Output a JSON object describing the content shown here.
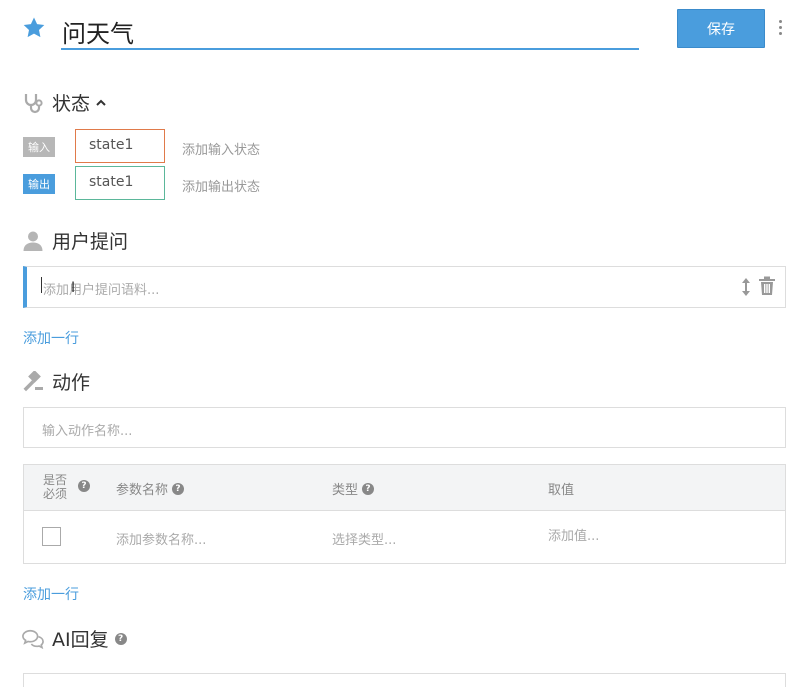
{
  "header": {
    "title": "问天气",
    "save_label": "保存"
  },
  "state": {
    "title": "状态",
    "input_tag": "输入",
    "output_tag": "输出",
    "input_value": "state1",
    "output_value": "state1",
    "add_input_label": "添加输入状态",
    "add_output_label": "添加输出状态"
  },
  "user_question": {
    "title": "用户提问",
    "placeholder": "添加用户提问语料...",
    "add_row_label": "添加一行"
  },
  "action": {
    "title": "动作",
    "name_placeholder": "输入动作名称...",
    "params": {
      "headers": {
        "required_line1": "是否",
        "required_line2": "必须",
        "name": "参数名称",
        "type": "类型",
        "value": "取值"
      },
      "row": {
        "name_placeholder": "添加参数名称...",
        "type_placeholder": "选择类型...",
        "value_placeholder": "添加值..."
      }
    },
    "add_row_label": "添加一行"
  },
  "ai_reply": {
    "title": "AI回复"
  },
  "colors": {
    "accent": "#4a9ddd",
    "input_state_border": "#e07a4a",
    "output_state_border": "#5bb79a"
  },
  "icons": [
    "star-icon",
    "more-vertical-icon",
    "stethoscope-icon",
    "chevron-up-icon",
    "user-icon",
    "sort-icon",
    "trash-icon",
    "gavel-icon",
    "help-icon",
    "chat-bubbles-icon"
  ]
}
